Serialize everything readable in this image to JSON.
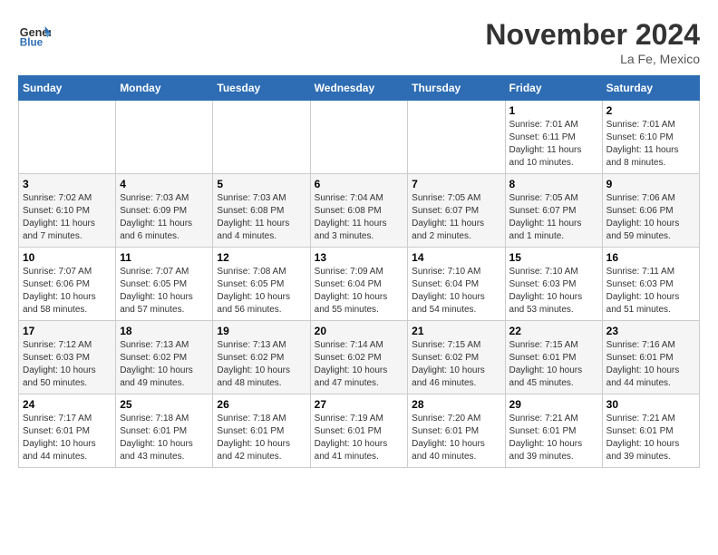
{
  "header": {
    "logo_line1": "General",
    "logo_line2": "Blue",
    "month": "November 2024",
    "location": "La Fe, Mexico"
  },
  "days_of_week": [
    "Sunday",
    "Monday",
    "Tuesday",
    "Wednesday",
    "Thursday",
    "Friday",
    "Saturday"
  ],
  "weeks": [
    [
      {
        "day": "",
        "info": ""
      },
      {
        "day": "",
        "info": ""
      },
      {
        "day": "",
        "info": ""
      },
      {
        "day": "",
        "info": ""
      },
      {
        "day": "",
        "info": ""
      },
      {
        "day": "1",
        "info": "Sunrise: 7:01 AM\nSunset: 6:11 PM\nDaylight: 11 hours and 10 minutes."
      },
      {
        "day": "2",
        "info": "Sunrise: 7:01 AM\nSunset: 6:10 PM\nDaylight: 11 hours and 8 minutes."
      }
    ],
    [
      {
        "day": "3",
        "info": "Sunrise: 7:02 AM\nSunset: 6:10 PM\nDaylight: 11 hours and 7 minutes."
      },
      {
        "day": "4",
        "info": "Sunrise: 7:03 AM\nSunset: 6:09 PM\nDaylight: 11 hours and 6 minutes."
      },
      {
        "day": "5",
        "info": "Sunrise: 7:03 AM\nSunset: 6:08 PM\nDaylight: 11 hours and 4 minutes."
      },
      {
        "day": "6",
        "info": "Sunrise: 7:04 AM\nSunset: 6:08 PM\nDaylight: 11 hours and 3 minutes."
      },
      {
        "day": "7",
        "info": "Sunrise: 7:05 AM\nSunset: 6:07 PM\nDaylight: 11 hours and 2 minutes."
      },
      {
        "day": "8",
        "info": "Sunrise: 7:05 AM\nSunset: 6:07 PM\nDaylight: 11 hours and 1 minute."
      },
      {
        "day": "9",
        "info": "Sunrise: 7:06 AM\nSunset: 6:06 PM\nDaylight: 10 hours and 59 minutes."
      }
    ],
    [
      {
        "day": "10",
        "info": "Sunrise: 7:07 AM\nSunset: 6:06 PM\nDaylight: 10 hours and 58 minutes."
      },
      {
        "day": "11",
        "info": "Sunrise: 7:07 AM\nSunset: 6:05 PM\nDaylight: 10 hours and 57 minutes."
      },
      {
        "day": "12",
        "info": "Sunrise: 7:08 AM\nSunset: 6:05 PM\nDaylight: 10 hours and 56 minutes."
      },
      {
        "day": "13",
        "info": "Sunrise: 7:09 AM\nSunset: 6:04 PM\nDaylight: 10 hours and 55 minutes."
      },
      {
        "day": "14",
        "info": "Sunrise: 7:10 AM\nSunset: 6:04 PM\nDaylight: 10 hours and 54 minutes."
      },
      {
        "day": "15",
        "info": "Sunrise: 7:10 AM\nSunset: 6:03 PM\nDaylight: 10 hours and 53 minutes."
      },
      {
        "day": "16",
        "info": "Sunrise: 7:11 AM\nSunset: 6:03 PM\nDaylight: 10 hours and 51 minutes."
      }
    ],
    [
      {
        "day": "17",
        "info": "Sunrise: 7:12 AM\nSunset: 6:03 PM\nDaylight: 10 hours and 50 minutes."
      },
      {
        "day": "18",
        "info": "Sunrise: 7:13 AM\nSunset: 6:02 PM\nDaylight: 10 hours and 49 minutes."
      },
      {
        "day": "19",
        "info": "Sunrise: 7:13 AM\nSunset: 6:02 PM\nDaylight: 10 hours and 48 minutes."
      },
      {
        "day": "20",
        "info": "Sunrise: 7:14 AM\nSunset: 6:02 PM\nDaylight: 10 hours and 47 minutes."
      },
      {
        "day": "21",
        "info": "Sunrise: 7:15 AM\nSunset: 6:02 PM\nDaylight: 10 hours and 46 minutes."
      },
      {
        "day": "22",
        "info": "Sunrise: 7:15 AM\nSunset: 6:01 PM\nDaylight: 10 hours and 45 minutes."
      },
      {
        "day": "23",
        "info": "Sunrise: 7:16 AM\nSunset: 6:01 PM\nDaylight: 10 hours and 44 minutes."
      }
    ],
    [
      {
        "day": "24",
        "info": "Sunrise: 7:17 AM\nSunset: 6:01 PM\nDaylight: 10 hours and 44 minutes."
      },
      {
        "day": "25",
        "info": "Sunrise: 7:18 AM\nSunset: 6:01 PM\nDaylight: 10 hours and 43 minutes."
      },
      {
        "day": "26",
        "info": "Sunrise: 7:18 AM\nSunset: 6:01 PM\nDaylight: 10 hours and 42 minutes."
      },
      {
        "day": "27",
        "info": "Sunrise: 7:19 AM\nSunset: 6:01 PM\nDaylight: 10 hours and 41 minutes."
      },
      {
        "day": "28",
        "info": "Sunrise: 7:20 AM\nSunset: 6:01 PM\nDaylight: 10 hours and 40 minutes."
      },
      {
        "day": "29",
        "info": "Sunrise: 7:21 AM\nSunset: 6:01 PM\nDaylight: 10 hours and 39 minutes."
      },
      {
        "day": "30",
        "info": "Sunrise: 7:21 AM\nSunset: 6:01 PM\nDaylight: 10 hours and 39 minutes."
      }
    ]
  ]
}
